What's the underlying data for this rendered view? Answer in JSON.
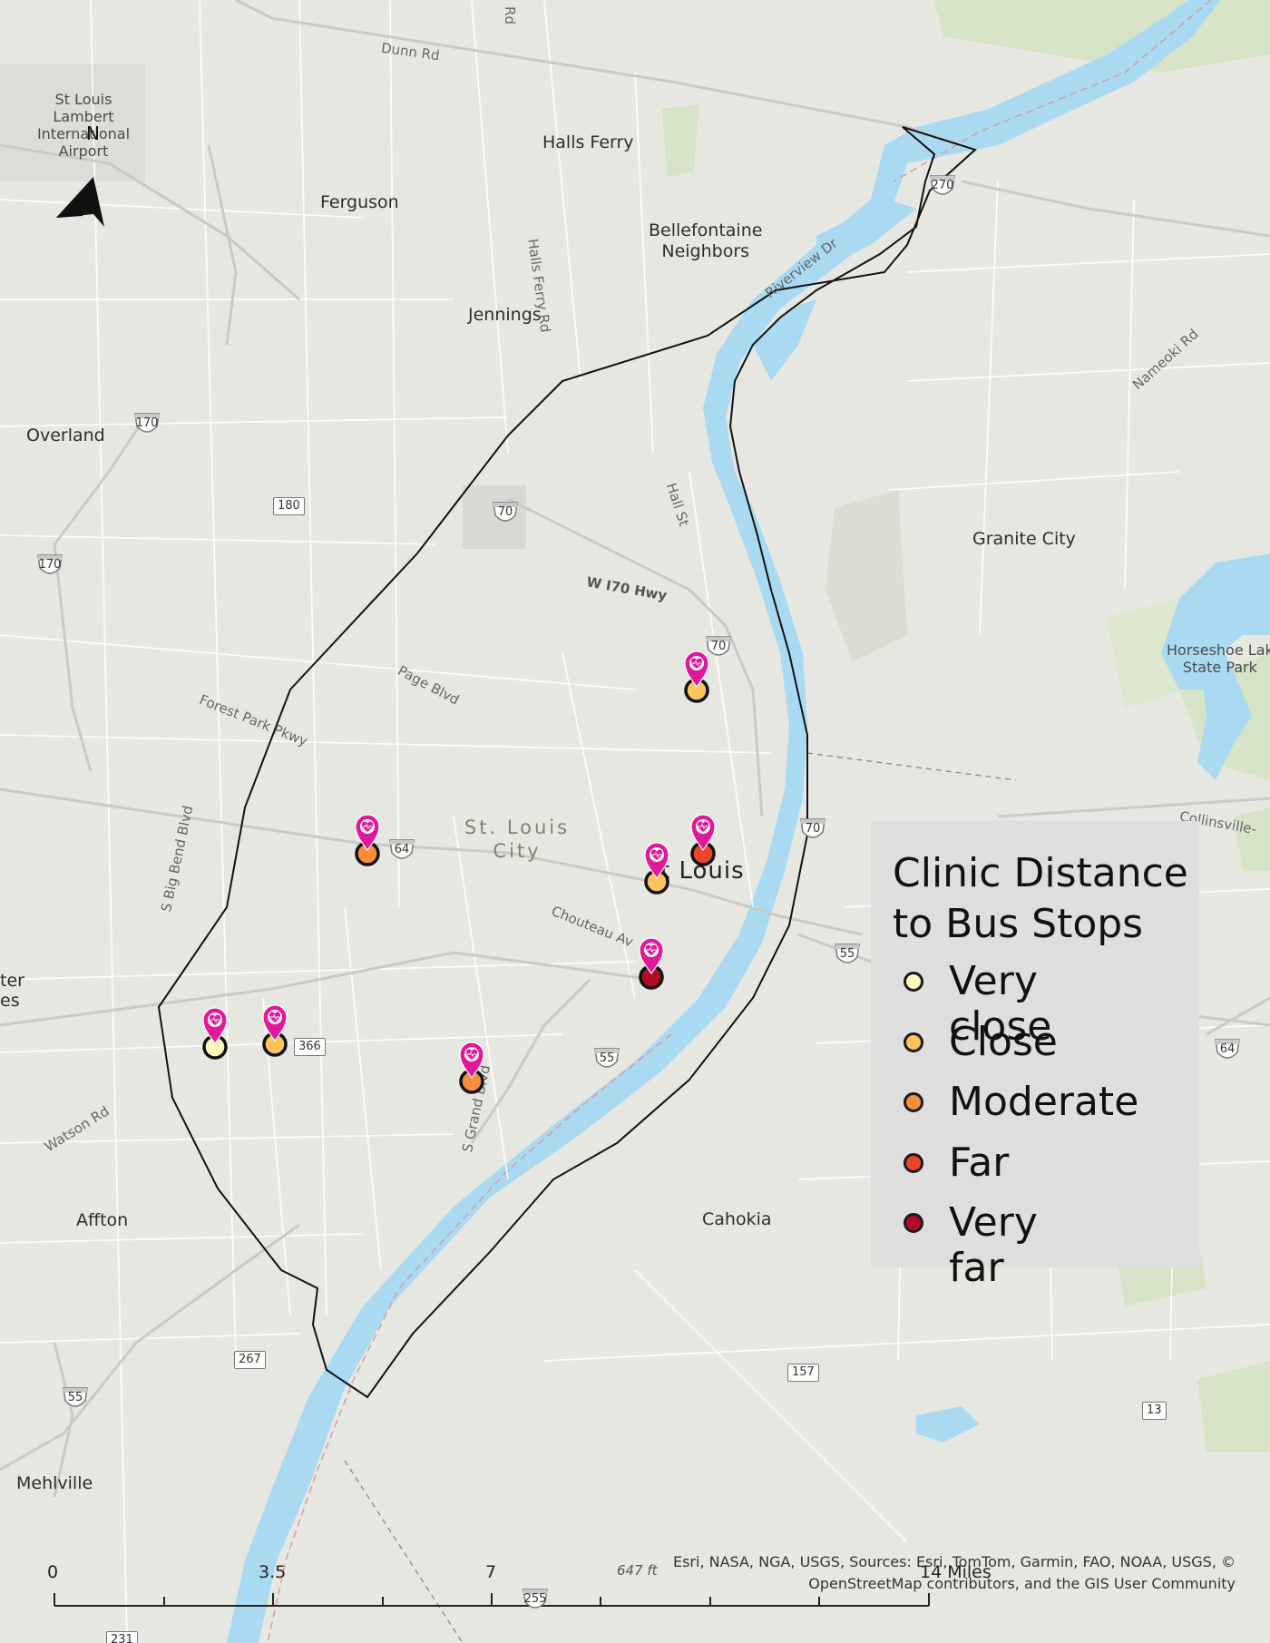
{
  "legend": {
    "title_line1": "Clinic Distance",
    "title_line2": "to Bus Stops",
    "items": [
      {
        "label": "Very close",
        "color": "#fff7bc"
      },
      {
        "label": "Close",
        "color": "#fdc45c"
      },
      {
        "label": "Moderate",
        "color": "#f98e3a"
      },
      {
        "label": "Far",
        "color": "#e8452a"
      },
      {
        "label": "Very far",
        "color": "#b10b26"
      }
    ]
  },
  "north_arrow": "N",
  "places": {
    "airport_1": "St Louis",
    "airport_2": "Lambert",
    "airport_3": "International",
    "airport_4": "Airport",
    "halls_ferry": "Halls Ferry",
    "ferguson": "Ferguson",
    "bellefontaine_1": "Bellefontaine",
    "bellefontaine_2": "Neighbors",
    "jennings": "Jennings",
    "overland": "Overland",
    "granite_city": "Granite City",
    "horseshoe_1": "Horseshoe Lak",
    "horseshoe_2": "State Park",
    "stl_city_1": "St. Louis",
    "stl_city_2": "City",
    "st_louis": "t Louis",
    "ster_1": "ter",
    "ster_2": "es",
    "affton": "Affton",
    "cahokia": "Cahokia",
    "mehlville": "Mehlville",
    "elevation": "647 ft"
  },
  "roads": {
    "dunn": "Dunn Rd",
    "rd_top": "Rd",
    "halls_ferry_rd": "Halls Ferry Rd",
    "riverview": "Riverview Dr",
    "nameoki": "Nameoki Rd",
    "hall_st": "Hall St",
    "w_i70": "W I70 Hwy",
    "page": "Page Blvd",
    "forest_park": "Forest Park Pkwy",
    "big_bend": "S Big Bend Blvd",
    "chouteau": "Chouteau Av",
    "watson": "Watson Rd",
    "s_grand": "S Grand Blvd",
    "collinsville": "Collinsville-"
  },
  "shields": {
    "i270": "270",
    "i170a": "170",
    "i170b": "170",
    "r180": "180",
    "i70a": "70",
    "i70b": "70",
    "i70c": "70",
    "i64a": "64",
    "i64b": "64",
    "i55a": "55",
    "i55b": "55",
    "i55c": "55",
    "r366": "366",
    "r267": "267",
    "r157": "157",
    "r13": "13",
    "i255": "255",
    "r231": "231"
  },
  "clinics": [
    {
      "name": "clinic-north",
      "category": "Close",
      "color": "#fdc45c"
    },
    {
      "name": "clinic-downtown-east",
      "category": "Far",
      "color": "#e8452a"
    },
    {
      "name": "clinic-downtown",
      "category": "Close",
      "color": "#fdc45c"
    },
    {
      "name": "clinic-midtown",
      "category": "Moderate",
      "color": "#f98e3a"
    },
    {
      "name": "clinic-south-downtown",
      "category": "Very far",
      "color": "#b10b26"
    },
    {
      "name": "clinic-southwest-1",
      "category": "Very close",
      "color": "#fff7bc"
    },
    {
      "name": "clinic-southwest-2",
      "category": "Close",
      "color": "#fdc45c"
    },
    {
      "name": "clinic-south-grand",
      "category": "Moderate",
      "color": "#f98e3a"
    }
  ],
  "scale_bar": {
    "labels": [
      "0",
      "3.5",
      "7",
      "14 Miles"
    ]
  },
  "attribution_line1": "Esri, NASA, NGA, USGS, Sources: Esri, TomTom, Garmin, FAO, NOAA, USGS, ©",
  "attribution_line2": "OpenStreetMap contributors, and the GIS User Community",
  "colors": {
    "water": "#a9daf2",
    "land": "#e7e7e2",
    "park": "#d6e3c6",
    "pin": "#e0189a",
    "boundary": "#111111"
  }
}
